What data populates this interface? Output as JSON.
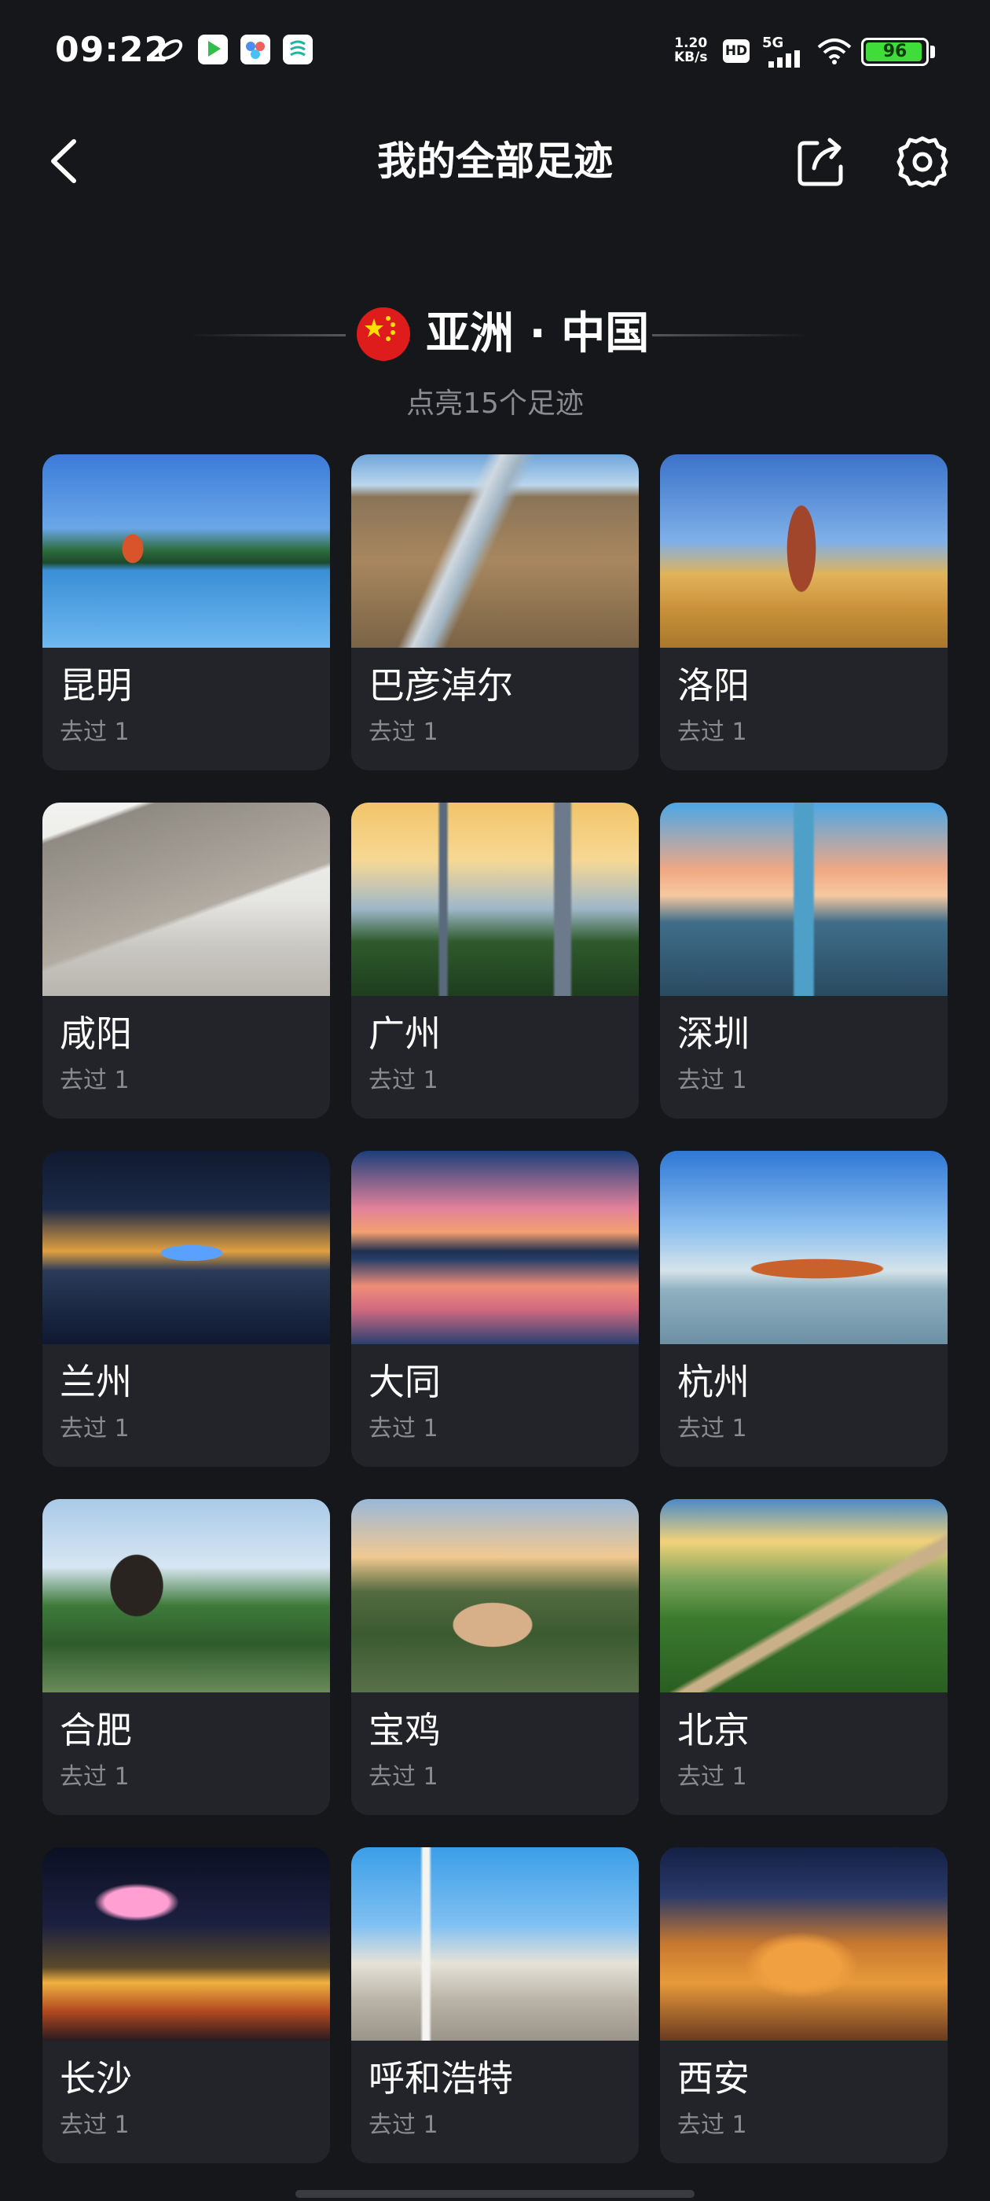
{
  "status_bar": {
    "time": "09:22",
    "net_speed_value": "1.20",
    "net_speed_unit": "KB/s",
    "hd_label": "HD",
    "signal_label": "5G",
    "battery": "96"
  },
  "header": {
    "title": "我的全部足迹",
    "back_icon": "chevron-left-icon",
    "share_icon": "share-icon",
    "settings_icon": "gear-icon"
  },
  "region": {
    "flag_icon": "china-flag-icon",
    "name": "亚洲 · 中国",
    "subtitle": "点亮15个足迹"
  },
  "cities": [
    {
      "name": "昆明",
      "visits": "去过 1"
    },
    {
      "name": "巴彦淖尔",
      "visits": "去过 1"
    },
    {
      "name": "洛阳",
      "visits": "去过 1"
    },
    {
      "name": "咸阳",
      "visits": "去过 1"
    },
    {
      "name": "广州",
      "visits": "去过 1"
    },
    {
      "name": "深圳",
      "visits": "去过 1"
    },
    {
      "name": "兰州",
      "visits": "去过 1"
    },
    {
      "name": "大同",
      "visits": "去过 1"
    },
    {
      "name": "杭州",
      "visits": "去过 1"
    },
    {
      "name": "合肥",
      "visits": "去过 1"
    },
    {
      "name": "宝鸡",
      "visits": "去过 1"
    },
    {
      "name": "北京",
      "visits": "去过 1"
    },
    {
      "name": "长沙",
      "visits": "去过 1"
    },
    {
      "name": "呼和浩特",
      "visits": "去过 1"
    },
    {
      "name": "西安",
      "visits": "去过 1"
    }
  ],
  "colors": {
    "background": "#16171b",
    "card": "#232429",
    "muted_text": "#8a8b90",
    "battery": "#3fdc3a",
    "flag_red": "#de1c1c",
    "flag_star": "#ffde00"
  }
}
